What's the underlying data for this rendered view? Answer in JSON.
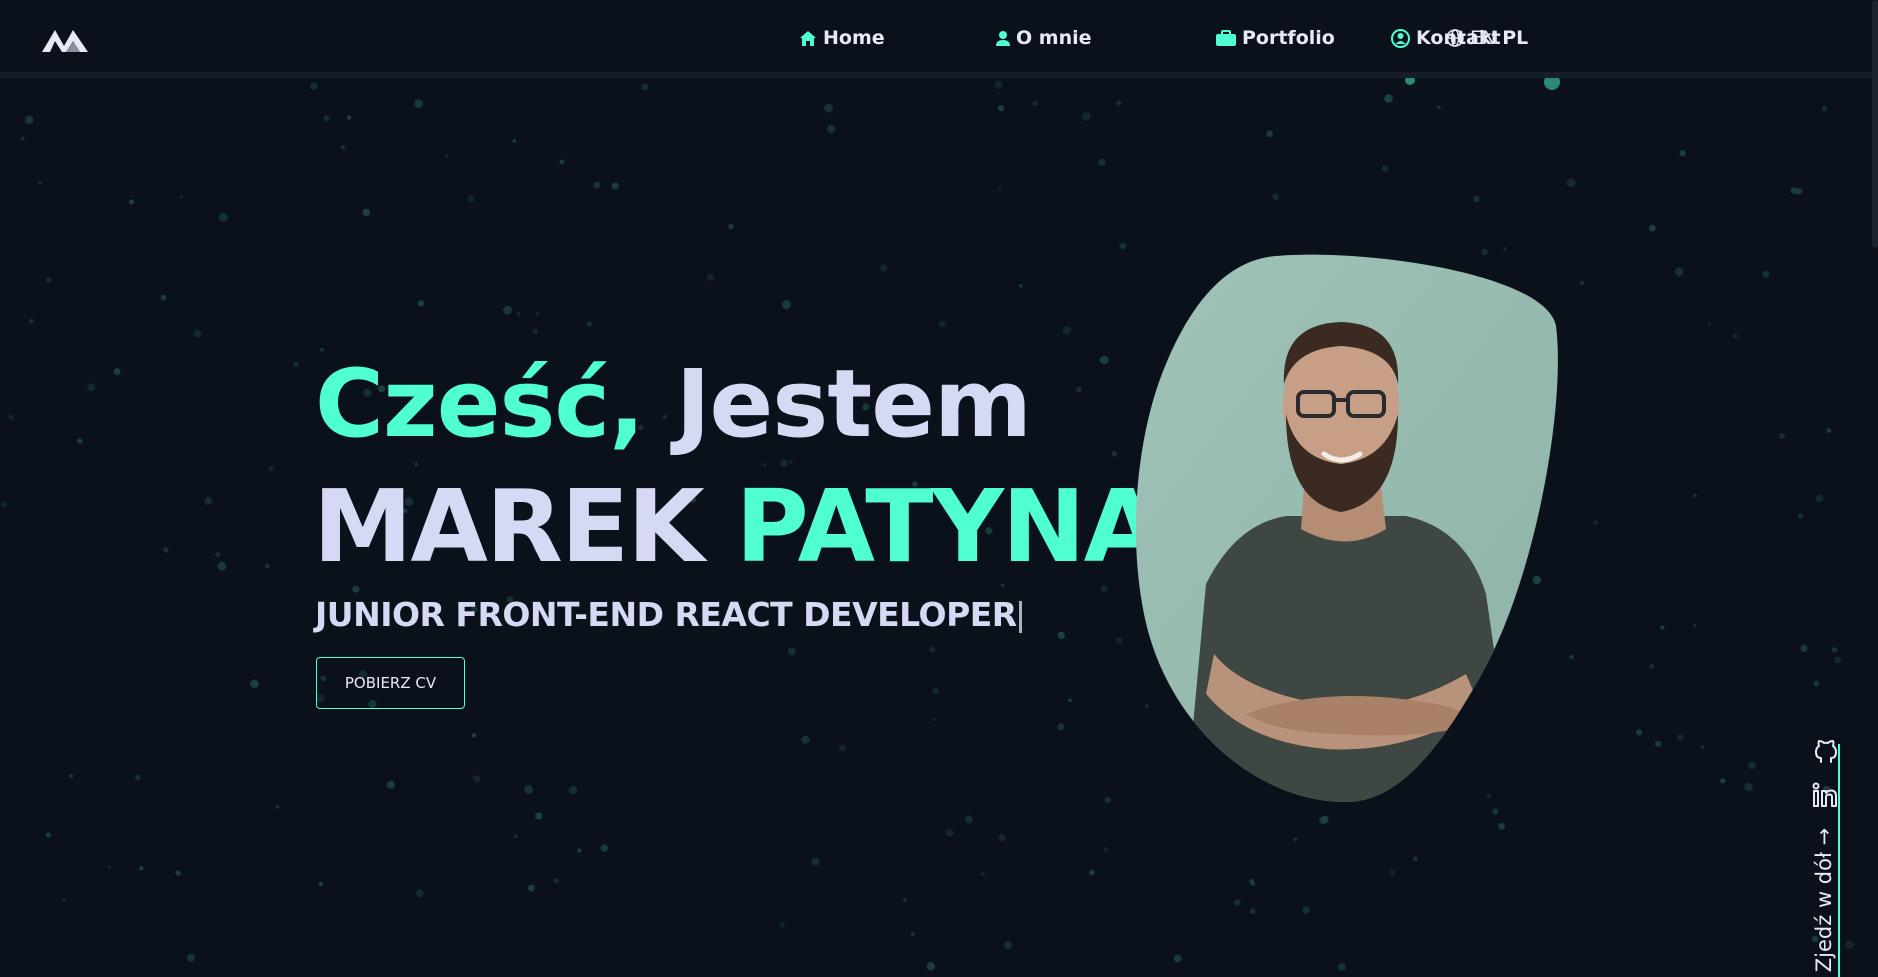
{
  "nav": {
    "items": [
      {
        "label": "Home",
        "icon": "home-icon"
      },
      {
        "label": "O mnie",
        "icon": "user-icon"
      },
      {
        "label": "Portfolio",
        "icon": "briefcase-icon"
      },
      {
        "label": "Kontakt",
        "icon": "contact-icon"
      }
    ],
    "lang": {
      "en": "EN",
      "pl": "PL",
      "icon": "globe-icon"
    }
  },
  "hero": {
    "greeting_accent": "Cześć,",
    "greeting_rest": "Jestem",
    "first_name": "MAREK",
    "last_name": "PATYNA",
    "role": "JUNIOR FRONT-END REACT DEVELOPER",
    "cv_button": "POBIERZ CV"
  },
  "side": {
    "scroll_label": "Zjedź w dół →",
    "icons": [
      "github-icon",
      "linkedin-icon"
    ]
  },
  "colors": {
    "background": "#0b111b",
    "accent": "#4fffd1",
    "text": "#d6d9f3"
  }
}
